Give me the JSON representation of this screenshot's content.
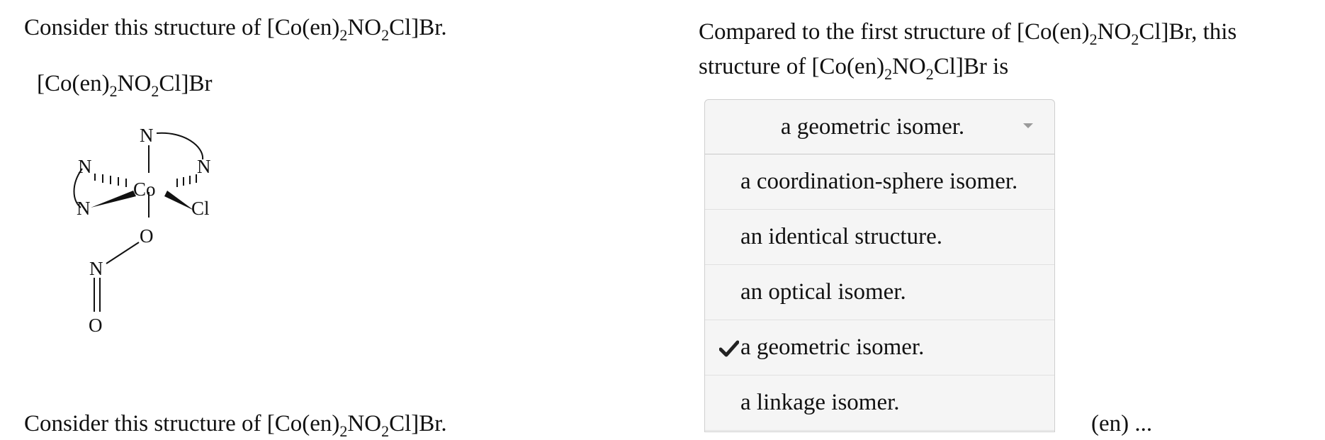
{
  "left": {
    "prompt_text": "Consider this structure of [Co(en)",
    "formula_label": "[Co(en)",
    "formula_rest": "Cl]Br",
    "molecule_atoms": {
      "n_top": "N",
      "n_upper_left": "N",
      "co": "Co",
      "n_upper_right": "N",
      "n_lower_left": "N",
      "cl": "Cl",
      "o_bridge": "O",
      "n_nitro": "N",
      "o_terminal": "O"
    },
    "bottom_prompt_text": "Consider this structure of [Co(en)"
  },
  "right": {
    "question_line1_prefix": "Compared to the first structure of [Co(en)",
    "question_line1_suffix": "Cl]Br, this",
    "question_line2_prefix": "structure of [Co(en)",
    "question_line2_suffix": "Cl]Br is",
    "dropdown": {
      "selected": "a geometric isomer.",
      "options": [
        {
          "label": "a coordination-sphere isomer.",
          "checked": false
        },
        {
          "label": "an identical structure.",
          "checked": false
        },
        {
          "label": "an optical isomer.",
          "checked": false
        },
        {
          "label": "a geometric isomer.",
          "checked": true
        },
        {
          "label": "a linkage isomer.",
          "checked": false
        }
      ]
    },
    "bottom_clip_text": "(en) ..."
  },
  "chem": {
    "sub2": "2",
    "no": "NO",
    "close_br": "Cl]Br."
  },
  "colors": {
    "dropdown_bg": "#f5f5f5",
    "border": "#cfcfcf",
    "text": "#111111"
  }
}
